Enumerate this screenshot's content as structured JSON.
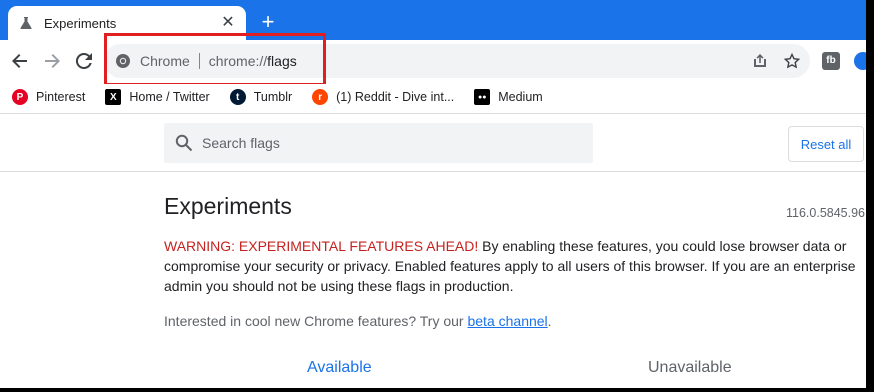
{
  "tab": {
    "title": "Experiments",
    "close": "✕",
    "new_tab": "+"
  },
  "omnibox": {
    "chip_label": "Chrome",
    "url_scheme": "chrome://",
    "url_path": "flags"
  },
  "toolbar": {
    "extension_label": "fb"
  },
  "bookmarks": [
    {
      "label": "Pinterest",
      "icon": "pinterest-icon",
      "color": "#e60023",
      "glyph": "P"
    },
    {
      "label": "Home / Twitter",
      "icon": "x-icon",
      "color": "#000000",
      "glyph": "X"
    },
    {
      "label": "Tumblr",
      "icon": "tumblr-icon",
      "color": "#001935",
      "glyph": "t"
    },
    {
      "label": "(1) Reddit - Dive int...",
      "icon": "reddit-icon",
      "color": "#ff4500",
      "glyph": "r"
    },
    {
      "label": "Medium",
      "icon": "medium-icon",
      "color": "#000000",
      "glyph": "●●"
    }
  ],
  "search": {
    "placeholder": "Search flags",
    "value": ""
  },
  "reset_label": "Reset all",
  "page": {
    "title": "Experiments",
    "version": "116.0.5845.96",
    "warning_prefix": "WARNING: EXPERIMENTAL FEATURES AHEAD!",
    "warning_body": " By enabling these features, you could lose browser data or compromise your security or privacy. Enabled features apply to all users of this browser. If you are an enterprise admin you should not be using these flags in production.",
    "interested_text": "Interested in cool new Chrome features? Try our ",
    "beta_link": "beta channel",
    "interested_end": "."
  },
  "tabs": {
    "available": "Available",
    "unavailable": "Unavailable"
  },
  "colors": {
    "accent": "#1a73e8",
    "warning": "#c5221f",
    "highlight": "#e02020"
  }
}
